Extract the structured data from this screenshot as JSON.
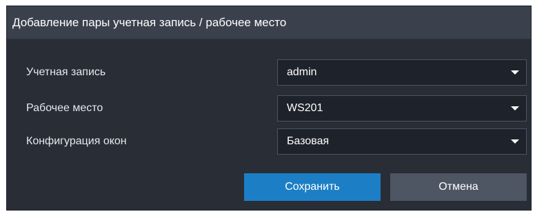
{
  "dialog": {
    "title": "Добавление пары учетная запись / рабочее место",
    "fields": [
      {
        "label": "Учетная запись",
        "value": "admin"
      },
      {
        "label": "Рабочее место",
        "value": "WS201"
      },
      {
        "label": "Конфигурация окон",
        "value": "Базовая"
      }
    ],
    "buttons": {
      "save_label": "Сохранить",
      "cancel_label": "Отмена"
    },
    "dropdown_icon": "caret-down-icon",
    "colors": {
      "background": "#282d36",
      "header": "#3b414c",
      "input_background": "#1e222a",
      "primary_button": "#1c7fc6",
      "secondary_button": "#4e5563",
      "text": "#ffffff"
    }
  }
}
